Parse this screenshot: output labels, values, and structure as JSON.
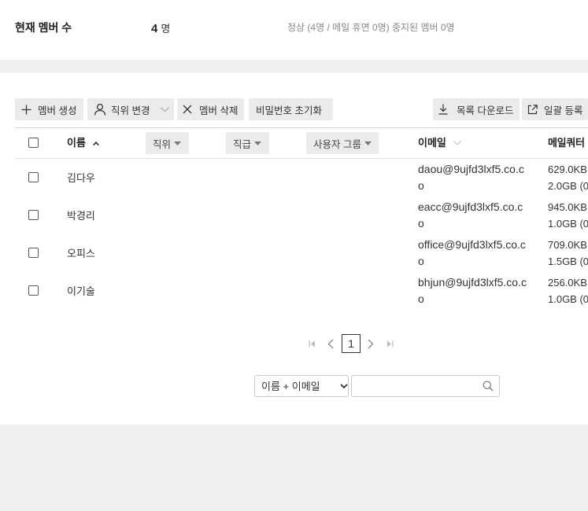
{
  "summary": {
    "label": "현재 멤버 수",
    "count": "4",
    "count_unit": "명",
    "detail": "정상 (4명 / 메일 휴면 0명) 중지된 멤버 0명"
  },
  "toolbar": {
    "create": {
      "label": "멤버 생성",
      "icon": "plus-icon"
    },
    "change_position": {
      "label": "직위 변경",
      "icon": "person-icon",
      "dropdown_icon": "chevron-down-icon"
    },
    "delete": {
      "label": "멤버 삭제",
      "icon": "close-icon"
    },
    "reset_password": {
      "label": "비밀번호 초기화"
    },
    "download": {
      "label": "목록 다운로드",
      "icon": "download-icon"
    },
    "bulk_register": {
      "label": "일괄 등록",
      "icon": "external-link-icon"
    }
  },
  "table": {
    "select_all_checked": false,
    "columns": {
      "name": {
        "label": "이름",
        "sort_icon": "chevron-up-icon"
      },
      "position": {
        "label": "직위",
        "icon": "caret-down-icon"
      },
      "rank": {
        "label": "직급",
        "icon": "caret-down-icon"
      },
      "group": {
        "label": "사용자 그룹",
        "icon": "caret-down-icon"
      },
      "email": {
        "label": "이메일",
        "sort_icon": "chevron-down-icon"
      },
      "quota": {
        "label": "메일쿼터"
      }
    },
    "rows": [
      {
        "checked": false,
        "name": "김다우",
        "email": "daou@9ujfd3lxf5.co.co",
        "quota_used": "629.0KB",
        "quota_total": "2.0GB (0"
      },
      {
        "checked": false,
        "name": "박경리",
        "email": "eacc@9ujfd3lxf5.co.co",
        "quota_used": "945.0KB",
        "quota_total": "1.0GB (0"
      },
      {
        "checked": false,
        "name": "오피스",
        "email": "office@9ujfd3lxf5.co.co",
        "quota_used": "709.0KB",
        "quota_total": "1.5GB (0"
      },
      {
        "checked": false,
        "name": "이기술",
        "email": "bhjun@9ujfd3lxf5.co.co",
        "quota_used": "256.0KB",
        "quota_total": "1.0GB (0"
      }
    ]
  },
  "pagination": {
    "current_page": "1",
    "icons": [
      "first-page-icon",
      "prev-page-icon",
      "next-page-icon",
      "last-page-icon"
    ]
  },
  "search": {
    "field_selected": "이름 + 이메일",
    "query": "",
    "icon": "search-icon"
  },
  "colors": {
    "text": "#333333",
    "muted_text": "#888888",
    "button_bg": "#ebebeb",
    "border": "#d6d6d6",
    "page_bg": "#f0f0f0"
  }
}
